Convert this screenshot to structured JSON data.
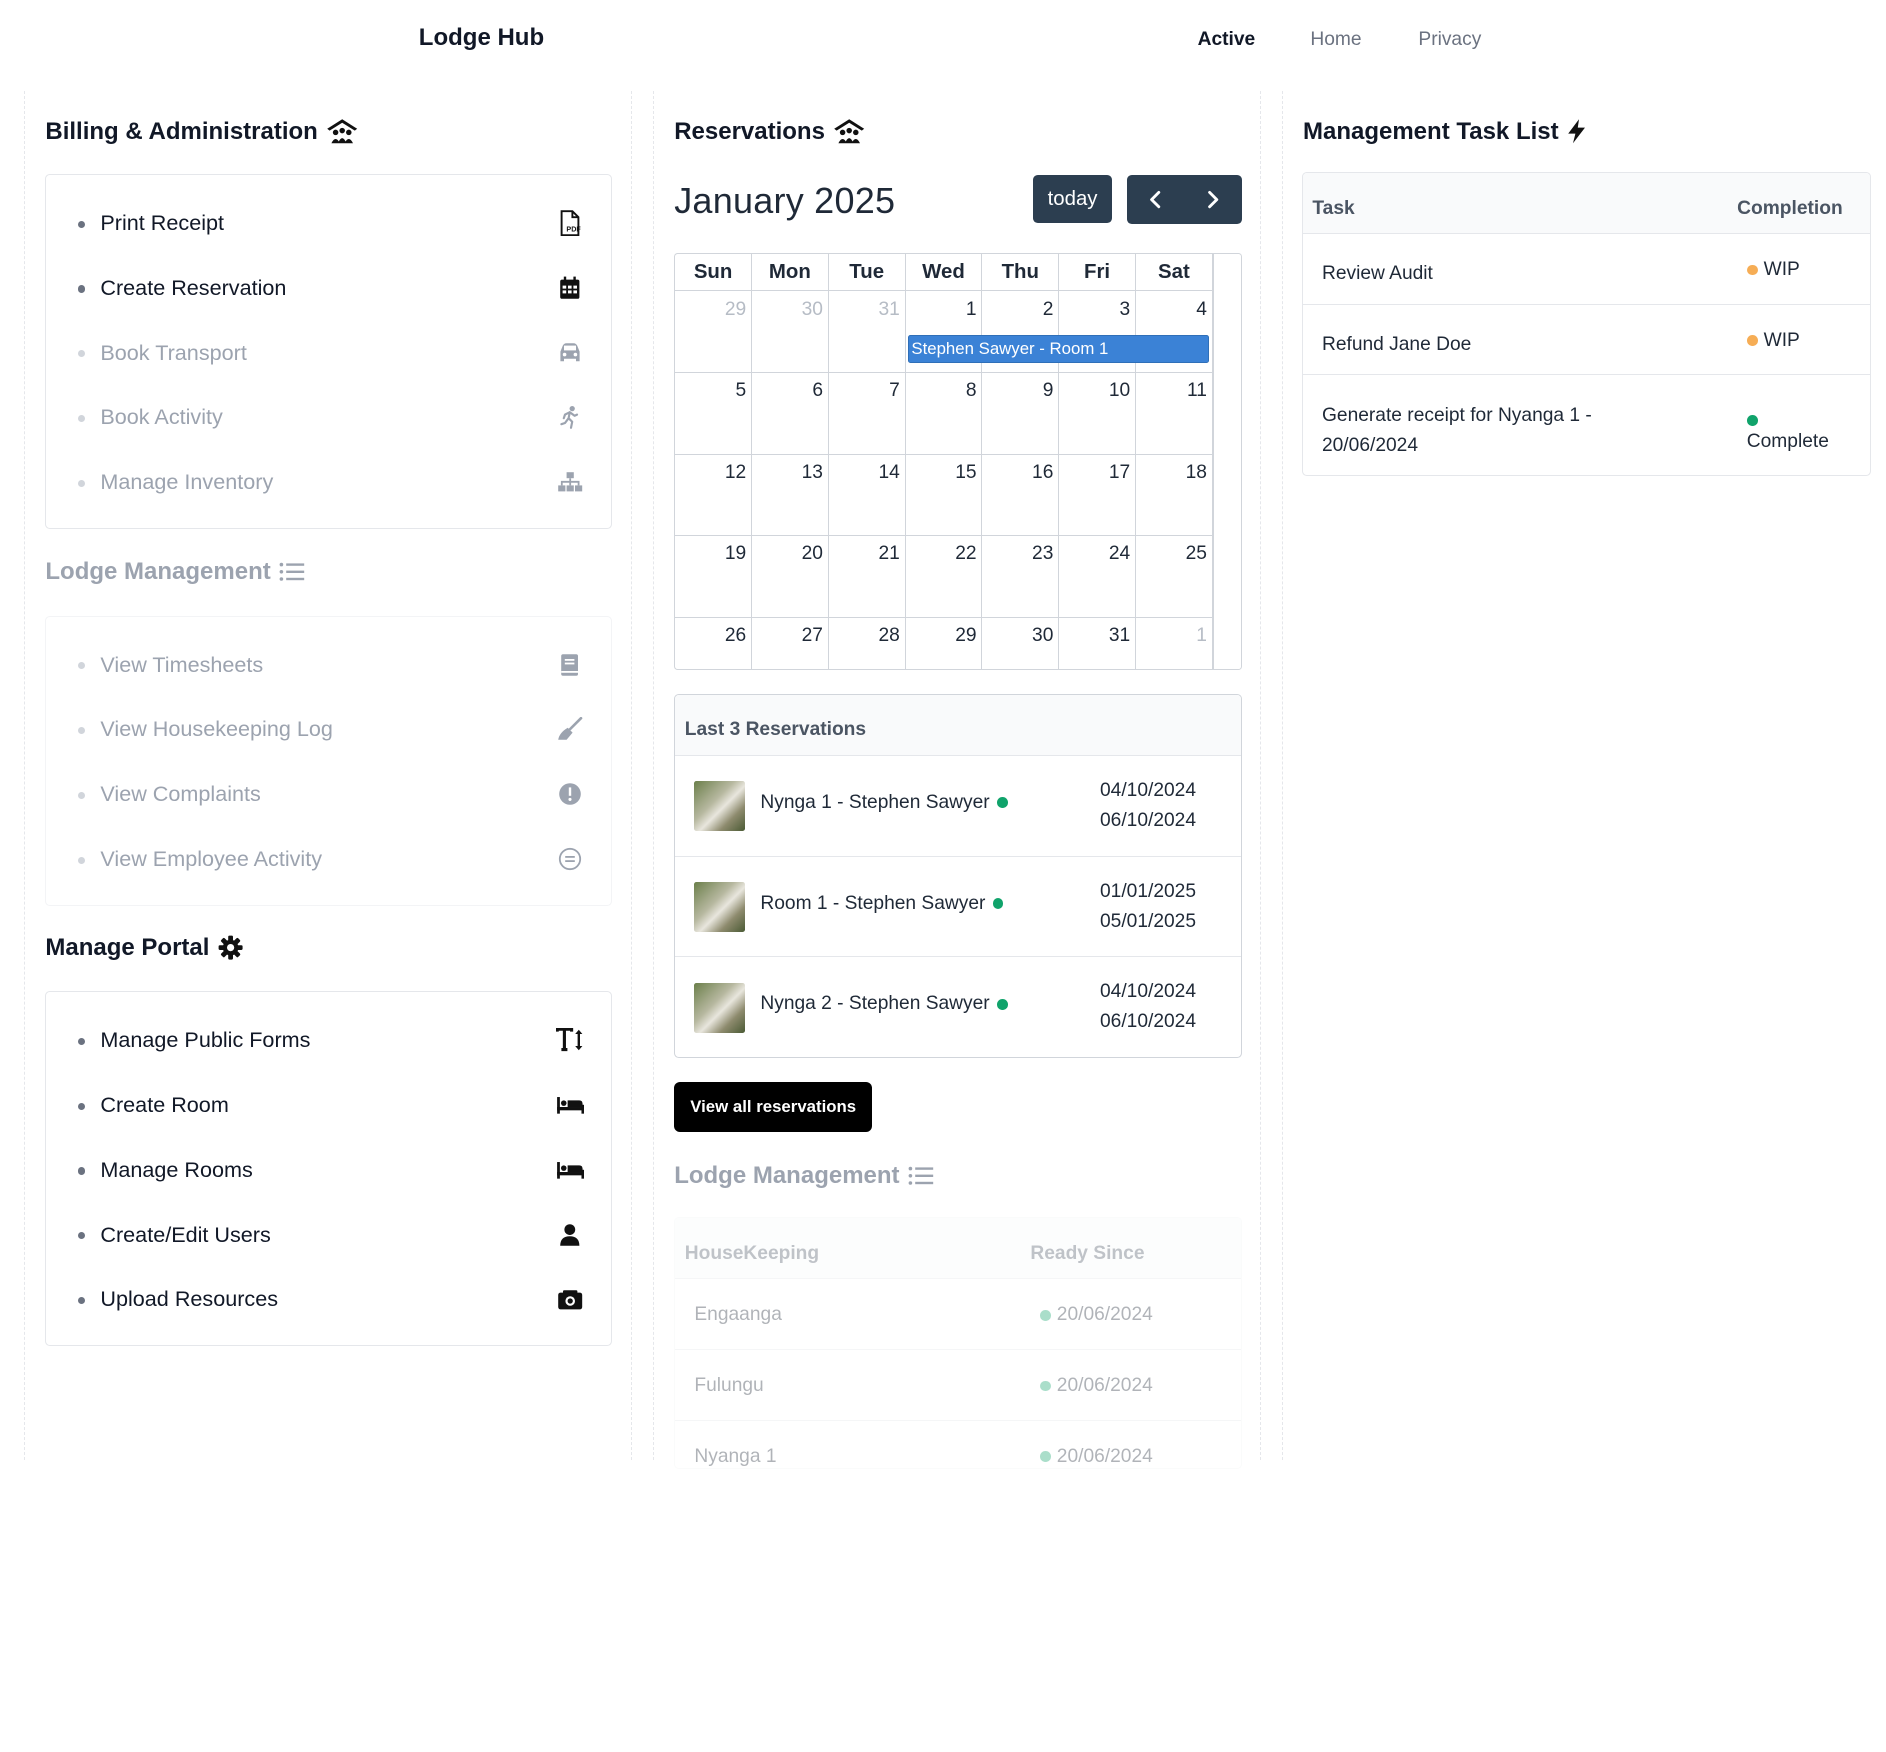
{
  "app": {
    "title": "Lodge Hub"
  },
  "nav": {
    "links": [
      "Active",
      "Home",
      "Privacy"
    ]
  },
  "billing": {
    "title": "Billing & Administration",
    "items": [
      {
        "label": "Print Receipt",
        "icon": "file-pdf-icon",
        "enabled": true
      },
      {
        "label": "Create Reservation",
        "icon": "calendar-icon",
        "enabled": true
      },
      {
        "label": "Book Transport",
        "icon": "car-icon",
        "enabled": false
      },
      {
        "label": "Book Activity",
        "icon": "running-person-icon",
        "enabled": false
      },
      {
        "label": "Manage Inventory",
        "icon": "sitemap-icon",
        "enabled": false
      }
    ]
  },
  "lodge_mgmt": {
    "title": "Lodge Management",
    "items": [
      {
        "label": "View Timesheets",
        "icon": "book-icon",
        "enabled": false
      },
      {
        "label": "View Housekeeping Log",
        "icon": "broom-icon",
        "enabled": false
      },
      {
        "label": "View Complaints",
        "icon": "exclamation-circle-icon",
        "enabled": false
      },
      {
        "label": "View Employee Activity",
        "icon": "equals-circle-icon",
        "enabled": false
      }
    ]
  },
  "portal": {
    "title": "Manage Portal",
    "items": [
      {
        "label": "Manage Public Forms",
        "icon": "text-height-icon",
        "enabled": true
      },
      {
        "label": "Create Room",
        "icon": "bed-icon",
        "enabled": true
      },
      {
        "label": "Manage Rooms",
        "icon": "bed-icon",
        "enabled": true
      },
      {
        "label": "Create/Edit Users",
        "icon": "user-icon",
        "enabled": true
      },
      {
        "label": "Upload Resources",
        "icon": "camera-icon",
        "enabled": true
      }
    ]
  },
  "reservations": {
    "title": "Reservations",
    "month_label": "January 2025",
    "today_label": "today",
    "weekdays": [
      "Sun",
      "Mon",
      "Tue",
      "Wed",
      "Thu",
      "Fri",
      "Sat"
    ],
    "weeks": [
      [
        "29",
        "30",
        "31",
        "1",
        "2",
        "3",
        "4"
      ],
      [
        "5",
        "6",
        "7",
        "8",
        "9",
        "10",
        "11"
      ],
      [
        "12",
        "13",
        "14",
        "15",
        "16",
        "17",
        "18"
      ],
      [
        "19",
        "20",
        "21",
        "22",
        "23",
        "24",
        "25"
      ],
      [
        "26",
        "27",
        "28",
        "29",
        "30",
        "31",
        "1"
      ]
    ],
    "event": "Stephen Sawyer - Room 1",
    "last3": {
      "title": "Last 3 Reservations",
      "rows": [
        {
          "name": "Nynga 1 - Stephen Sawyer",
          "start": "04/10/2024",
          "end": "06/10/2024"
        },
        {
          "name": "Room 1 - Stephen Sawyer",
          "start": "01/01/2025",
          "end": "05/01/2025"
        },
        {
          "name": "Nynga 2 - Stephen Sawyer",
          "start": "04/10/2024",
          "end": "06/10/2024"
        }
      ]
    },
    "view_all_label": "View all reservations"
  },
  "lodge_mgmt_mid": {
    "title": "Lodge Management",
    "columns": [
      "HouseKeeping",
      "Ready Since"
    ],
    "rows": [
      {
        "name": "Engaanga",
        "since": "20/06/2024"
      },
      {
        "name": "Fulungu",
        "since": "20/06/2024"
      },
      {
        "name": "Nyanga 1",
        "since": "20/06/2024"
      }
    ]
  },
  "tasks": {
    "title": "Management Task List",
    "columns": [
      "Task",
      "Completion"
    ],
    "rows": [
      {
        "task": "Review Audit",
        "status": "WIP"
      },
      {
        "task": "Refund Jane Doe",
        "status": "WIP"
      },
      {
        "task": "Generate receipt for Nyanga 1 - 20/06/2024",
        "status": "Complete"
      }
    ]
  },
  "colors": {
    "primary_button": "#2c3e50",
    "event": "#3b82d6",
    "status_complete": "#10a36b",
    "status_wip": "#f6ad55"
  }
}
